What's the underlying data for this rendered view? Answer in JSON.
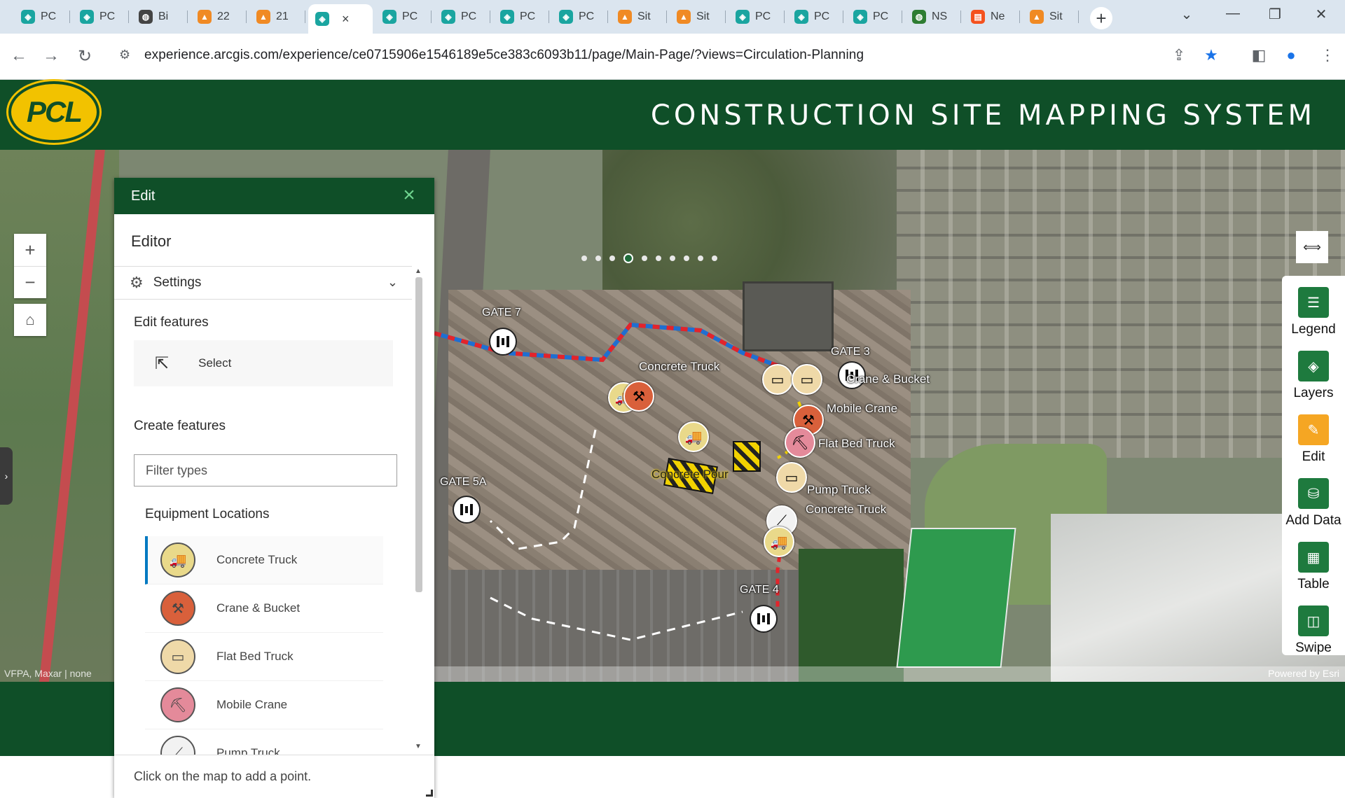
{
  "browser": {
    "tabs": [
      {
        "label": "PC",
        "icon": "pcl-app-icon",
        "color": "#1aa5a0"
      },
      {
        "label": "PC",
        "icon": "pcl-app-icon",
        "color": "#1aa5a0"
      },
      {
        "label": "Bi",
        "icon": "globe-icon",
        "color": "#444444"
      },
      {
        "label": "22",
        "icon": "arcgis-icon",
        "color": "#f08a24"
      },
      {
        "label": "21",
        "icon": "arcgis-icon",
        "color": "#f08a24"
      },
      {
        "label": "",
        "icon": "pcl-app-icon",
        "color": "#1aa5a0",
        "active": true
      },
      {
        "label": "PC",
        "icon": "pcl-app-icon",
        "color": "#1aa5a0"
      },
      {
        "label": "PC",
        "icon": "pcl-app-icon",
        "color": "#1aa5a0"
      },
      {
        "label": "PC",
        "icon": "pcl-app-icon",
        "color": "#1aa5a0"
      },
      {
        "label": "PC",
        "icon": "pcl-app-icon",
        "color": "#1aa5a0"
      },
      {
        "label": "Sit",
        "icon": "arcgis-icon",
        "color": "#f08a24"
      },
      {
        "label": "Sit",
        "icon": "arcgis-icon",
        "color": "#f08a24"
      },
      {
        "label": "PC",
        "icon": "pcl-app-icon",
        "color": "#1aa5a0"
      },
      {
        "label": "PC",
        "icon": "pcl-app-icon",
        "color": "#1aa5a0"
      },
      {
        "label": "PC",
        "icon": "pcl-app-icon",
        "color": "#1aa5a0"
      },
      {
        "label": "NS",
        "icon": "globe-icon",
        "color": "#2e7d32"
      },
      {
        "label": "Ne",
        "icon": "news-icon",
        "color": "#f4511e"
      },
      {
        "label": "Sit",
        "icon": "arcgis-icon",
        "color": "#f08a24"
      }
    ],
    "url": "experience.arcgis.com/experience/ce0715906e1546189e5ce383c6093b11/page/Main-Page/?views=Circulation-Planning"
  },
  "header": {
    "logo_text": "PCL",
    "title": "CONSTRUCTION SITE MAPPING SYSTEM"
  },
  "map": {
    "attribution_left": "VFPA, Maxar | none",
    "attribution_right": "Powered by Esri",
    "gates": [
      "GATE 7",
      "GATE 3",
      "GATE 5A",
      "GATE 4"
    ],
    "labels": {
      "concrete_truck_1": "Concrete Truck",
      "crane_bucket": "Crane & Bucket",
      "mobile_crane": "Mobile Crane",
      "flat_bed_truck": "Flat Bed Truck",
      "concrete_pour": "Concrete Pour",
      "pump_truck": "Pump Truck",
      "concrete_truck_2": "Concrete Truck"
    },
    "page_dots": 10,
    "active_dot": 3
  },
  "widgets": [
    {
      "label": "Legend",
      "icon": "legend-icon",
      "color": "#1e7a3e"
    },
    {
      "label": "Layers",
      "icon": "layers-icon",
      "color": "#1e7a3e"
    },
    {
      "label": "Edit",
      "icon": "edit-icon",
      "color": "#f5a623"
    },
    {
      "label": "Add Data",
      "icon": "add-data-icon",
      "color": "#1e7a3e"
    },
    {
      "label": "Table",
      "icon": "table-icon",
      "color": "#1e7a3e"
    },
    {
      "label": "Swipe",
      "icon": "swipe-icon",
      "color": "#1e7a3e"
    }
  ],
  "panel": {
    "title": "Edit",
    "editor_heading": "Editor",
    "settings_label": "Settings",
    "edit_features_title": "Edit features",
    "select_label": "Select",
    "create_features_title": "Create features",
    "filter_placeholder": "Filter types",
    "group_title": "Equipment Locations",
    "types": [
      {
        "label": "Concrete Truck",
        "color": "#e9d98a",
        "selected": true
      },
      {
        "label": "Crane & Bucket",
        "color": "#d9603b"
      },
      {
        "label": "Flat Bed Truck",
        "color": "#efd9a8"
      },
      {
        "label": "Mobile Crane",
        "color": "#e48a9a"
      },
      {
        "label": "Pump Truck",
        "color": "#f2f2f2"
      }
    ],
    "footer_hint": "Click on the map to add a point."
  },
  "colors": {
    "brand_green": "#0f4f28",
    "logo_yellow": "#f2c200",
    "route_red": "#e3242b",
    "route_blue": "#1f6fd1"
  }
}
